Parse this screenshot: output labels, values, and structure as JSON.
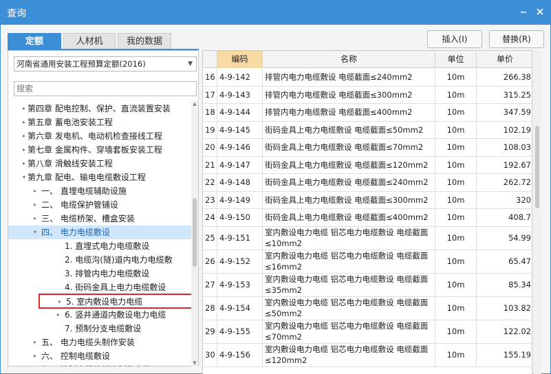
{
  "window": {
    "title": "查询"
  },
  "tabs": [
    "定额",
    "人材机",
    "我的数据"
  ],
  "actions": {
    "insert": "插入(I)",
    "replace": "替换(R)"
  },
  "library": {
    "selected": "河南省通用安装工程预算定额(2016)"
  },
  "search": {
    "placeholder": "搜索"
  },
  "tree": [
    "第四章 配电控制、保护、直流装置安装",
    "第五章 蓄电池安装工程",
    "第六章 发电机、电动机检查接线工程",
    "第七章 金属构件、穿墙套板安装工程",
    "第八章 滑触线安装工程",
    "第九章 配电、输电电缆敷设工程",
    "一、 直埋电缆辅助设施",
    "二、 电缆保护管铺设",
    "三、 电缆桥架、槽盒安装",
    "四、 电力电缆敷设",
    "1. 直埋式电力电缆敷设",
    "2. 电缆沟(隧)道内电力电缆敷",
    "3. 排管内电力电缆敷设",
    "4. 街码金具上电力电缆敷设",
    "5. 室内敷设电力电缆",
    "6. 竖井通道内敷设电力电缆",
    "7. 预制分支电缆敷设",
    "五、 电力电缆头制作安装",
    "六、 控制电缆敷设",
    "七、 控制电缆终端头制作安装"
  ],
  "grid": {
    "columns": [
      "编码",
      "名称",
      "单位",
      "单价"
    ],
    "rows": [
      {
        "no": "16",
        "code": "4-9-142",
        "name": "排管内电力电缆敷设 电缆截面≤240mm2",
        "unit": "10m",
        "price": "266.38"
      },
      {
        "no": "17",
        "code": "4-9-143",
        "name": "排管内电力电缆敷设 电缆截面≤300mm2",
        "unit": "10m",
        "price": "315.25"
      },
      {
        "no": "18",
        "code": "4-9-144",
        "name": "排管内电力电缆敷设 电缆截面≤400mm2",
        "unit": "10m",
        "price": "347.59"
      },
      {
        "no": "19",
        "code": "4-9-145",
        "name": "街码金具上电力电缆敷设 电缆截面≤50mm2",
        "unit": "10m",
        "price": "102.19"
      },
      {
        "no": "20",
        "code": "4-9-146",
        "name": "街码金具上电力电缆敷设 电缆截面≤70mm2",
        "unit": "10m",
        "price": "108.03"
      },
      {
        "no": "21",
        "code": "4-9-147",
        "name": "街码金具上电力电缆敷设 电缆截面≤120mm2",
        "unit": "10m",
        "price": "192.67"
      },
      {
        "no": "22",
        "code": "4-9-148",
        "name": "街码金具上电力电缆敷设 电缆截面≤240mm2",
        "unit": "10m",
        "price": "262.72"
      },
      {
        "no": "23",
        "code": "4-9-149",
        "name": "街码金具上电力电缆敷设 电缆截面≤300mm2",
        "unit": "10m",
        "price": "320"
      },
      {
        "no": "24",
        "code": "4-9-150",
        "name": "街码金具上电力电缆敷设 电缆截面≤400mm2",
        "unit": "10m",
        "price": "408.7"
      },
      {
        "no": "25",
        "code": "4-9-151",
        "name": "室内敷设电力电缆 铝芯电力电缆敷设 电缆截面≤10mm2",
        "unit": "10m",
        "price": "54.99"
      },
      {
        "no": "26",
        "code": "4-9-152",
        "name": "室内敷设电力电缆 铝芯电力电缆敷设 电缆截面≤16mm2",
        "unit": "10m",
        "price": "65.47"
      },
      {
        "no": "27",
        "code": "4-9-153",
        "name": "室内敷设电力电缆 铝芯电力电缆敷设 电缆截面≤35mm2",
        "unit": "10m",
        "price": "85.34"
      },
      {
        "no": "28",
        "code": "4-9-154",
        "name": "室内敷设电力电缆 铝芯电力电缆敷设 电缆截面≤50mm2",
        "unit": "10m",
        "price": "103.82"
      },
      {
        "no": "29",
        "code": "4-9-155",
        "name": "室内敷设电力电缆 铝芯电力电缆敷设 电缆截面≤70mm2",
        "unit": "10m",
        "price": "122.02"
      },
      {
        "no": "30",
        "code": "4-9-156",
        "name": "室内敷设电力电缆 铝芯电力电缆敷设 电缆截面≤120mm2",
        "unit": "10m",
        "price": "155.19"
      }
    ]
  }
}
